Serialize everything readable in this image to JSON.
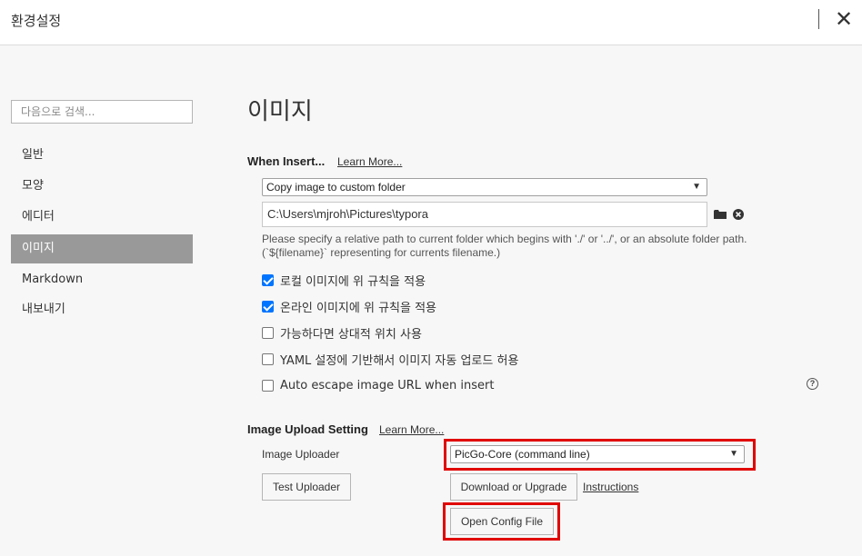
{
  "window": {
    "title": "환경설정",
    "close_glyph": "✕"
  },
  "sidebar": {
    "search_placeholder": "다음으로 검색...",
    "items": [
      {
        "label": "일반"
      },
      {
        "label": "모양"
      },
      {
        "label": "에디터"
      },
      {
        "label": "이미지",
        "active": true
      },
      {
        "label": "Markdown"
      },
      {
        "label": "내보내기"
      }
    ]
  },
  "main": {
    "title": "이미지",
    "when_insert": {
      "label": "When Insert...",
      "learn_more": "Learn More...",
      "action_select": "Copy image to custom folder",
      "path_value": "C:\\Users\\mjroh\\Pictures\\typora",
      "hint": "Please specify a relative path to current folder which begins with './' or '../', or an absolute folder path. (`${filename}` representing for currents filename.)",
      "options": [
        {
          "label": "로컬 이미지에 위 규칙을 적용",
          "checked": true
        },
        {
          "label": "온라인 이미지에 위 규칙을 적용",
          "checked": true
        },
        {
          "label": "가능하다면 상대적 위치 사용",
          "checked": false
        },
        {
          "label": "YAML 설정에 기반해서 이미지 자동 업로드 허용",
          "checked": false
        },
        {
          "label": "Auto escape image URL when insert",
          "checked": false
        }
      ],
      "help_glyph": "?"
    },
    "upload": {
      "label": "Image Upload Setting",
      "learn_more": "Learn More...",
      "uploader_label": "Image Uploader",
      "uploader_value": "PicGo-Core (command line)",
      "test_button": "Test Uploader",
      "download_button": "Download or Upgrade",
      "instructions_link": "Instructions",
      "open_config_button": "Open Config File"
    }
  },
  "colors": {
    "highlight": "#e00000",
    "checkbox": "#0075ff",
    "active_nav": "#999999"
  },
  "icons": {
    "folder": "folder-icon",
    "clear": "clear-circle-icon",
    "help": "help-circle-icon"
  }
}
